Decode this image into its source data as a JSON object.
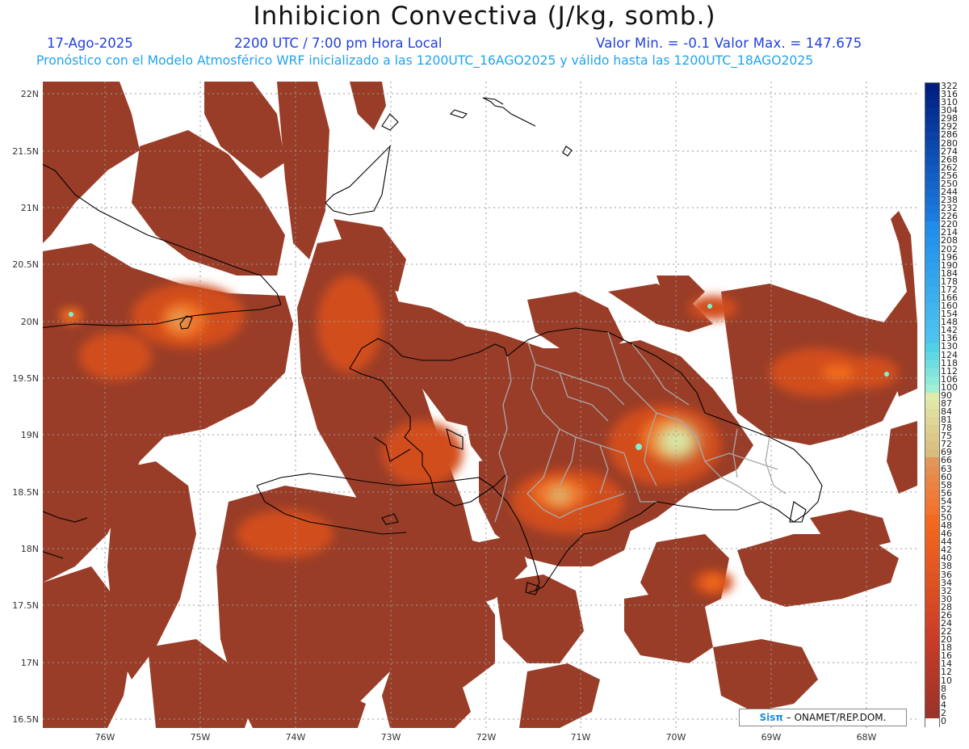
{
  "header": {
    "title": "Inhibicion Convectiva (J/kg, somb.)",
    "date": "17-Ago-2025",
    "time": "2200 UTC / 7:00 pm Hora Local",
    "min_max": "Valor Min. = -0.1  Valor Max. = 147.675",
    "forecast": "Pronóstico con el Modelo Atmosférico WRF inicializado a las 1200UTC_16AGO2025 y válido hasta las  1200UTC_18AGO2025"
  },
  "axes": {
    "lat_labels": [
      "22N",
      "21.5N",
      "21N",
      "20.5N",
      "20N",
      "19.5N",
      "19N",
      "18.5N",
      "18N",
      "17.5N",
      "17N",
      "16.5N"
    ],
    "lon_labels": [
      "76W",
      "75W",
      "74W",
      "73W",
      "72W",
      "71W",
      "70W",
      "69W",
      "68W"
    ]
  },
  "colorbar": {
    "labels": [
      "322",
      "316",
      "310",
      "304",
      "298",
      "292",
      "286",
      "280",
      "274",
      "268",
      "262",
      "256",
      "250",
      "244",
      "238",
      "232",
      "226",
      "220",
      "214",
      "208",
      "202",
      "196",
      "190",
      "184",
      "178",
      "172",
      "166",
      "160",
      "154",
      "148",
      "142",
      "136",
      "130",
      "124",
      "118",
      "112",
      "106",
      "100",
      "90",
      "87",
      "84",
      "81",
      "78",
      "75",
      "72",
      "69",
      "66",
      "63",
      "60",
      "58",
      "56",
      "54",
      "52",
      "50",
      "48",
      "46",
      "44",
      "42",
      "40",
      "38",
      "36",
      "34",
      "32",
      "30",
      "28",
      "26",
      "24",
      "22",
      "20",
      "18",
      "16",
      "14",
      "12",
      "10",
      "8",
      "6",
      "4",
      "2",
      "0"
    ]
  },
  "colors": {
    "cin_low": "#993d28",
    "cin_mid": "#c5441c",
    "cin_orange": "#e35a1a",
    "cin_light": "#d8e8a6",
    "cin_cyan": "#7ef0d8",
    "coast": "#000000",
    "provinces": "#a9a9a9",
    "grid": "#9a9a9a"
  },
  "credit": {
    "brand": "Sisπ",
    "text": "– ONAMET/REP.DOM."
  }
}
